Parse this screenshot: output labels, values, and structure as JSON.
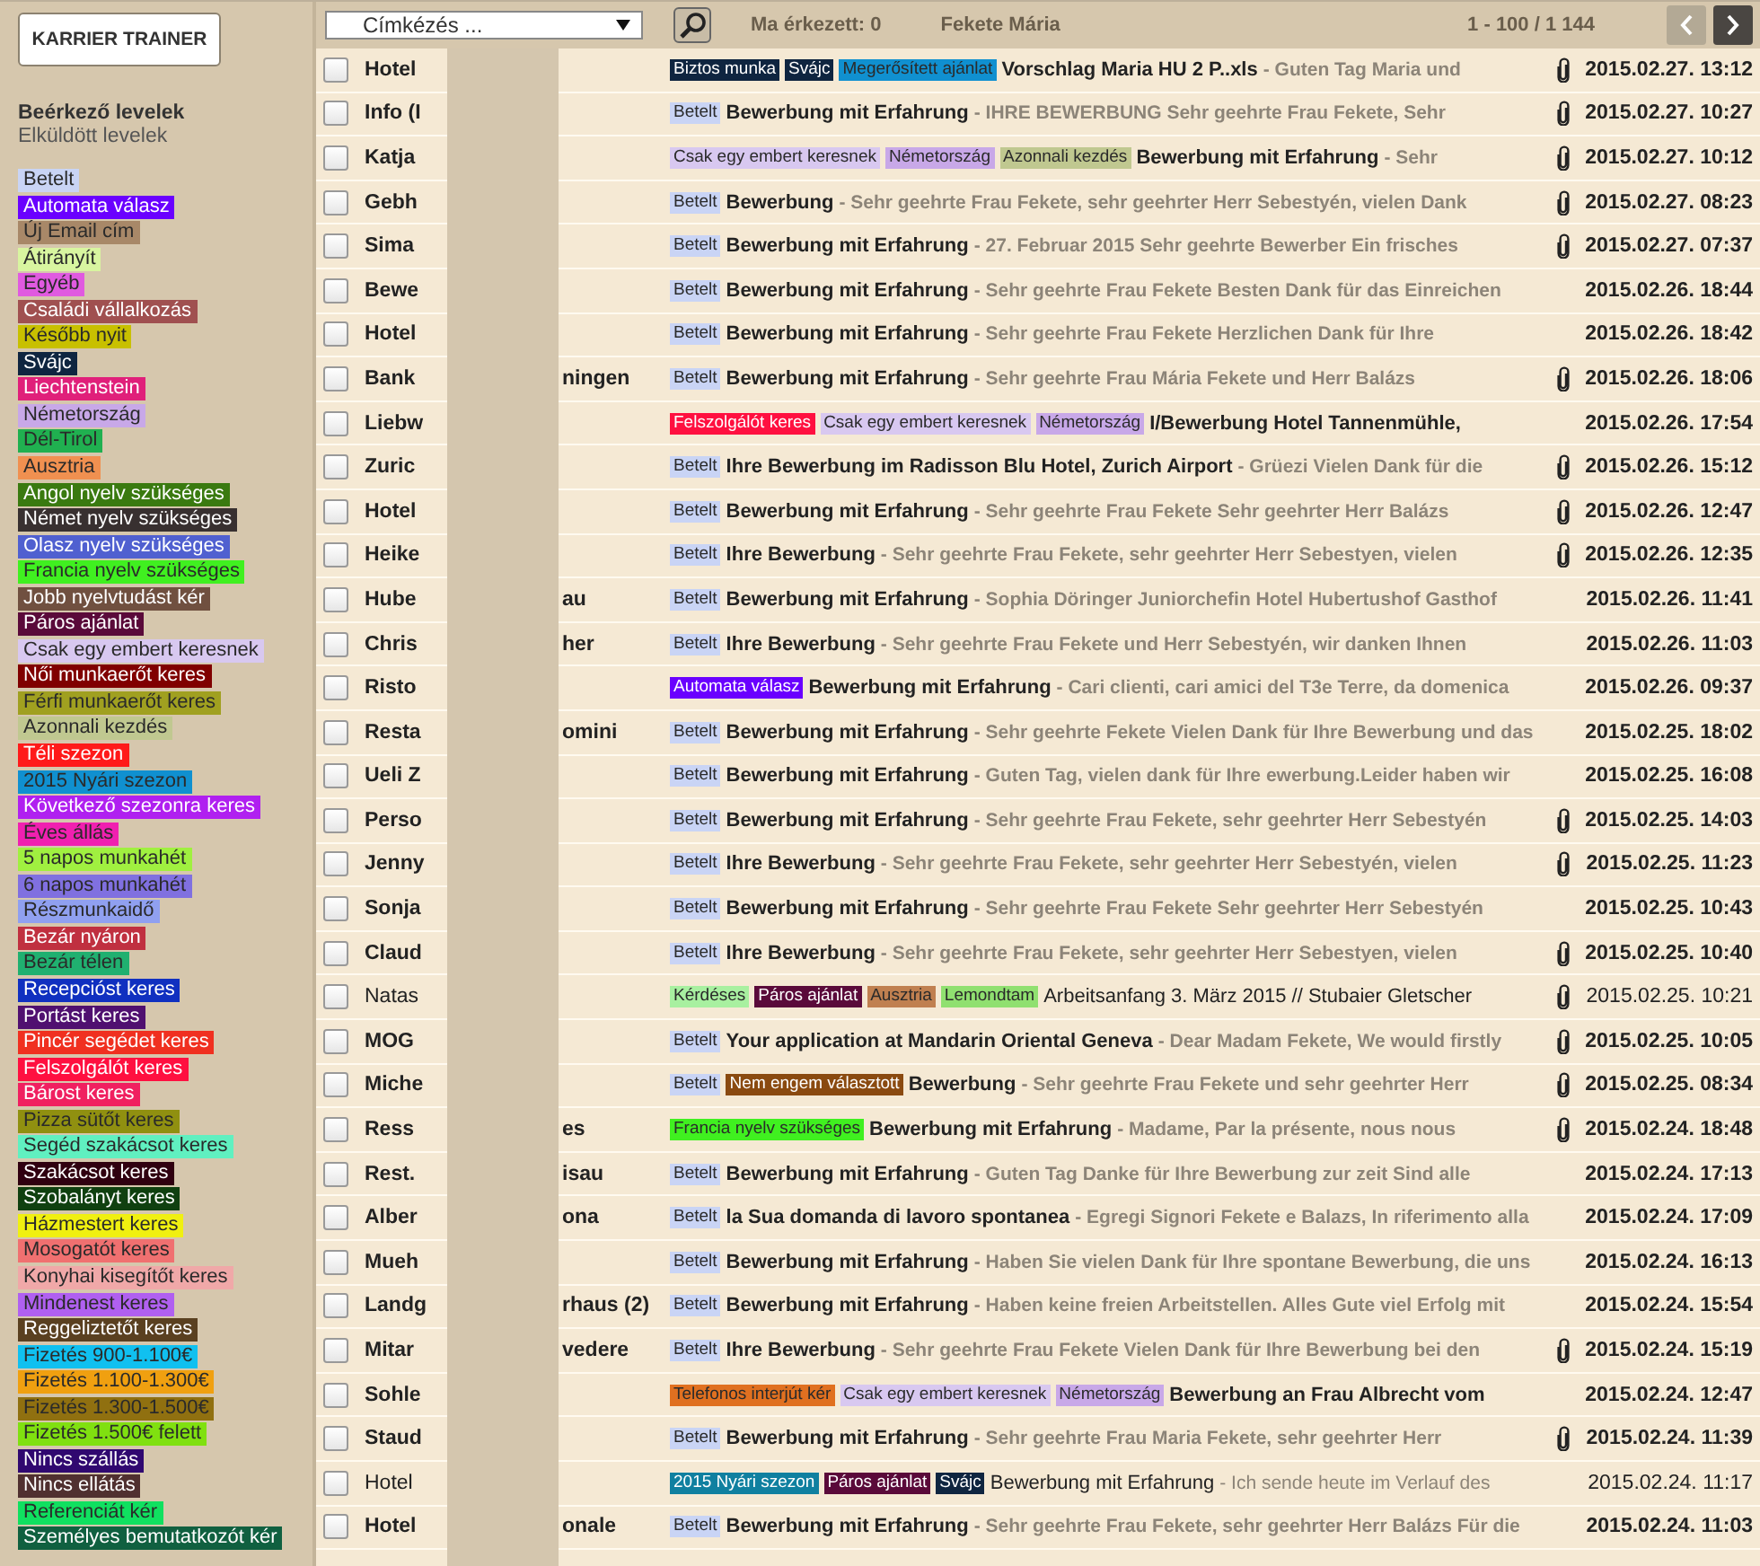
{
  "sidebar": {
    "brand_button": "KARRIER TRAINER",
    "folders": [
      {
        "label": "Beérkező levelek",
        "selected": true
      },
      {
        "label": "Elküldött levelek",
        "selected": false
      }
    ],
    "labels": [
      {
        "label": "Betelt",
        "color": "#c9d4f5"
      },
      {
        "label": "Automata válasz",
        "color": "#6a00ff"
      },
      {
        "label": "Új Email cím",
        "color": "#a88868"
      },
      {
        "label": "Átirányít",
        "color": "#d8f5a0"
      },
      {
        "label": "Egyéb",
        "color": "#e05ae0"
      },
      {
        "label": "Családi vállalkozás",
        "color": "#a05050"
      },
      {
        "label": "Később nyit",
        "color": "#c8c000"
      },
      {
        "label": "Svájc",
        "color": "#0f2540"
      },
      {
        "label": "Liechtenstein",
        "color": "#e0207a"
      },
      {
        "label": "Németország",
        "color": "#c8a8e8"
      },
      {
        "label": "Dél-Tirol",
        "color": "#20b050"
      },
      {
        "label": "Ausztria",
        "color": "#f09050"
      },
      {
        "label": "Angol nyelv szükséges",
        "color": "#3a7a10"
      },
      {
        "label": "Német nyelv szükséges",
        "color": "#383030"
      },
      {
        "label": "Olasz nyelv szükséges",
        "color": "#5060d0"
      },
      {
        "label": "Francia nyelv szükséges",
        "color": "#40f020"
      },
      {
        "label": "Jobb nyelvtudást kér",
        "color": "#705040"
      },
      {
        "label": "Páros ajánlat",
        "color": "#5a0a3a"
      },
      {
        "label": "Csak egy embert keresnek",
        "color": "#d8c8f0"
      },
      {
        "label": "Női munkaerőt keres",
        "color": "#800000"
      },
      {
        "label": "Férfi munkaerőt keres",
        "color": "#a0a020"
      },
      {
        "label": "Azonnali kezdés",
        "color": "#c0c890"
      },
      {
        "label": "Téli szezon",
        "color": "#ff1a1a"
      },
      {
        "label": "2015 Nyári szezon",
        "color": "#1090d0"
      },
      {
        "label": "Következő szezonra keres",
        "color": "#b020f0"
      },
      {
        "label": "Éves állás",
        "color": "#f020b0"
      },
      {
        "label": "5 napos munkahét",
        "color": "#a0f040"
      },
      {
        "label": "6 napos munkahét",
        "color": "#8070e0"
      },
      {
        "label": "Részmunkaidő",
        "color": "#90a0f0"
      },
      {
        "label": "Bezár nyáron",
        "color": "#c03040"
      },
      {
        "label": "Bezár télen",
        "color": "#20b070"
      },
      {
        "label": "Recepcióst keres",
        "color": "#1030c0"
      },
      {
        "label": "Portást keres",
        "color": "#501070"
      },
      {
        "label": "Pincér segédet keres",
        "color": "#f03020"
      },
      {
        "label": "Felszolgálót keres",
        "color": "#ff1040"
      },
      {
        "label": "Bárost keres",
        "color": "#f02060"
      },
      {
        "label": "Pizza sütőt keres",
        "color": "#909010"
      },
      {
        "label": "Segéd szakácsot keres",
        "color": "#60f0c0"
      },
      {
        "label": "Szakácsot keres",
        "color": "#300010"
      },
      {
        "label": "Szobalányt keres",
        "color": "#104010"
      },
      {
        "label": "Házmestert keres",
        "color": "#f0f010"
      },
      {
        "label": "Mosogatót keres",
        "color": "#f07070"
      },
      {
        "label": "Konyhai kisegítőt keres",
        "color": "#f0a8a8"
      },
      {
        "label": "Mindenest keres",
        "color": "#b060f0"
      },
      {
        "label": "Reggeliztetőt keres",
        "color": "#5a4020"
      },
      {
        "label": "Fizetés 900-1.100€",
        "color": "#10c0f0"
      },
      {
        "label": "Fizetés 1.100-1.300€",
        "color": "#f0a010"
      },
      {
        "label": "Fizetés 1.300-1.500€",
        "color": "#907010"
      },
      {
        "label": "Fizetés 1.500€ felett",
        "color": "#80e010"
      },
      {
        "label": "Nincs szállás",
        "color": "#300870"
      },
      {
        "label": "Nincs ellátás",
        "color": "#503030"
      },
      {
        "label": "Referenciát kér",
        "color": "#10e060"
      },
      {
        "label": "Személyes bemutatkozót kér",
        "color": "#106040"
      }
    ]
  },
  "toolbar": {
    "label_dropdown": "Címkézés ...",
    "today": "Ma érkezett: 0",
    "user": "Fekete Mária",
    "range": "1 - 100 / 1 144",
    "prev_disabled": true,
    "next_disabled": false
  },
  "messages": [
    {
      "checked": false,
      "read": false,
      "sender": "Hotel",
      "tags": [
        {
          "label": "Biztos munka",
          "color": "#0f2540"
        },
        {
          "label": "Svájc",
          "color": "#0f2540"
        },
        {
          "label": "Megerősített ajánlat",
          "color": "#1090d0"
        }
      ],
      "subject": "Vorschlag Maria HU 2 P..xls",
      "preview": "- Guten Tag Maria und",
      "attachment": true,
      "date": "2015.02.27. 13:12"
    },
    {
      "checked": false,
      "read": false,
      "sender": "Info (I",
      "tags": [
        {
          "label": "Betelt",
          "color": "#c9d4f5"
        }
      ],
      "subject": "Bewerbung mit Erfahrung",
      "preview": "- IHRE BEWERBUNG Sehr geehrte Frau Fekete, Sehr",
      "attachment": true,
      "date": "2015.02.27. 10:27"
    },
    {
      "checked": false,
      "read": false,
      "sender": "Katja",
      "tags": [
        {
          "label": "Csak egy embert keresnek",
          "color": "#d8c8f0"
        },
        {
          "label": "Németország",
          "color": "#c8a8e8"
        },
        {
          "label": "Azonnali kezdés",
          "color": "#c0c890"
        }
      ],
      "subject": "Bewerbung mit Erfahrung",
      "preview": "- Sehr",
      "attachment": true,
      "date": "2015.02.27. 10:12"
    },
    {
      "checked": false,
      "read": false,
      "sender": "Gebh",
      "tags": [
        {
          "label": "Betelt",
          "color": "#c9d4f5"
        }
      ],
      "subject": "Bewerbung",
      "preview": "- Sehr geehrte Frau Fekete, sehr geehrter Herr Sebestyén, vielen Dank",
      "attachment": true,
      "date": "2015.02.27. 08:23"
    },
    {
      "checked": false,
      "read": false,
      "sender": "Sima",
      "tags": [
        {
          "label": "Betelt",
          "color": "#c9d4f5"
        }
      ],
      "subject": "Bewerbung mit Erfahrung",
      "preview": "- 27. Februar 2015 Sehr geehrte Bewerber Ein frisches",
      "attachment": true,
      "date": "2015.02.27. 07:37"
    },
    {
      "checked": false,
      "read": false,
      "sender": "Bewe",
      "tags": [
        {
          "label": "Betelt",
          "color": "#c9d4f5"
        }
      ],
      "subject": "Bewerbung mit Erfahrung",
      "preview": "- Sehr geehrte Frau Fekete Besten Dank für das Einreichen",
      "attachment": false,
      "date": "2015.02.26. 18:44"
    },
    {
      "checked": false,
      "read": false,
      "sender": "Hotel",
      "tags": [
        {
          "label": "Betelt",
          "color": "#c9d4f5"
        }
      ],
      "subject": "Bewerbung mit Erfahrung",
      "preview": "- Sehr geehrte Frau Fekete Herzlichen Dank für Ihre",
      "attachment": false,
      "date": "2015.02.26. 18:42"
    },
    {
      "checked": false,
      "read": false,
      "sender": "Bank",
      "sender_tail": "ningen",
      "tags": [
        {
          "label": "Betelt",
          "color": "#c9d4f5"
        }
      ],
      "subject": "Bewerbung mit Erfahrung",
      "preview": "- Sehr geehrte Frau Mária Fekete und Herr Balázs",
      "attachment": true,
      "date": "2015.02.26. 18:06"
    },
    {
      "checked": false,
      "read": false,
      "sender": "Liebw",
      "tags": [
        {
          "label": "Felszolgálót keres",
          "color": "#ff1040"
        },
        {
          "label": "Csak egy embert keresnek",
          "color": "#d8c8f0"
        },
        {
          "label": "Németország",
          "color": "#c8a8e8"
        }
      ],
      "subject": "I/Bewerbung Hotel Tannenmühle,",
      "attachment": false,
      "date": "2015.02.26. 17:54"
    },
    {
      "checked": false,
      "read": false,
      "sender": "Zuric",
      "tags": [
        {
          "label": "Betelt",
          "color": "#c9d4f5"
        }
      ],
      "subject": "Ihre Bewerbung im Radisson Blu Hotel, Zurich Airport",
      "preview": "- Grüezi Vielen Dank für die",
      "attachment": true,
      "date": "2015.02.26. 15:12"
    },
    {
      "checked": false,
      "read": false,
      "sender": "Hotel",
      "tags": [
        {
          "label": "Betelt",
          "color": "#c9d4f5"
        }
      ],
      "subject": "Bewerbung mit Erfahrung",
      "preview": "- Sehr geehrte Frau Fekete Sehr geehrter Herr Balázs",
      "attachment": true,
      "date": "2015.02.26. 12:47"
    },
    {
      "checked": false,
      "read": false,
      "sender": "Heike",
      "tags": [
        {
          "label": "Betelt",
          "color": "#c9d4f5"
        }
      ],
      "subject": "Ihre Bewerbung",
      "preview": "- Sehr geehrte Frau Fekete, sehr geehrter Herr Sebestyen, vielen",
      "attachment": true,
      "date": "2015.02.26. 12:35"
    },
    {
      "checked": false,
      "read": false,
      "sender": "Hube",
      "sender_tail": "au",
      "tags": [
        {
          "label": "Betelt",
          "color": "#c9d4f5"
        }
      ],
      "subject": "Bewerbung mit Erfahrung",
      "preview": "- Sophia Döringer Juniorchefin Hotel Hubertushof Gasthof",
      "attachment": false,
      "date": "2015.02.26. 11:41"
    },
    {
      "checked": false,
      "read": false,
      "sender": "Chris",
      "sender_tail": "her",
      "tags": [
        {
          "label": "Betelt",
          "color": "#c9d4f5"
        }
      ],
      "subject": "Ihre Bewerbung",
      "preview": "- Sehr geehrte Frau Fekete und Herr Sebestyén, wir danken Ihnen",
      "attachment": false,
      "date": "2015.02.26. 11:03"
    },
    {
      "checked": false,
      "read": false,
      "sender": "Risto",
      "tags": [
        {
          "label": "Automata válasz",
          "color": "#6a00ff"
        }
      ],
      "subject": "Bewerbung mit Erfahrung",
      "preview": "- Cari clienti, cari amici del T3e Terre, da domenica",
      "attachment": false,
      "date": "2015.02.26. 09:37"
    },
    {
      "checked": false,
      "read": false,
      "sender": "Resta",
      "sender_tail": "omini",
      "tags": [
        {
          "label": "Betelt",
          "color": "#c9d4f5"
        }
      ],
      "subject": "Bewerbung mit Erfahrung",
      "preview": "- Sehr geehrte Fekete Vielen Dank für Ihre Bewerbung und das",
      "attachment": false,
      "date": "2015.02.25. 18:02"
    },
    {
      "checked": false,
      "read": false,
      "sender": "Ueli Z",
      "tags": [
        {
          "label": "Betelt",
          "color": "#c9d4f5"
        }
      ],
      "subject": "Bewerbung mit Erfahrung",
      "preview": "- Guten Tag, vielen dank für Ihre ewerbung.Leider haben wir",
      "attachment": false,
      "date": "2015.02.25. 16:08"
    },
    {
      "checked": false,
      "read": false,
      "sender": "Perso",
      "tags": [
        {
          "label": "Betelt",
          "color": "#c9d4f5"
        }
      ],
      "subject": "Bewerbung mit Erfahrung",
      "preview": "- Sehr geehrte Frau Fekete, sehr geehrter Herr Sebestyén",
      "attachment": true,
      "date": "2015.02.25. 14:03"
    },
    {
      "checked": false,
      "read": false,
      "sender": "Jenny",
      "tags": [
        {
          "label": "Betelt",
          "color": "#c9d4f5"
        }
      ],
      "subject": "Ihre Bewerbung",
      "preview": "- Sehr geehrte Frau Fekete, sehr geehrter Herr Sebestyén, vielen",
      "attachment": true,
      "date": "2015.02.25. 11:23"
    },
    {
      "checked": false,
      "read": false,
      "sender": "Sonja",
      "tags": [
        {
          "label": "Betelt",
          "color": "#c9d4f5"
        }
      ],
      "subject": "Bewerbung mit Erfahrung",
      "preview": "- Sehr geehrte Frau Fekete Sehr geehrter Herr Sebestyén",
      "attachment": false,
      "date": "2015.02.25. 10:43"
    },
    {
      "checked": false,
      "read": false,
      "sender": "Claud",
      "tags": [
        {
          "label": "Betelt",
          "color": "#c9d4f5"
        }
      ],
      "subject": "Ihre Bewerbung",
      "preview": "- Sehr geehrte Frau Fekete, sehr geehrter Herr Sebestyen, vielen",
      "attachment": true,
      "date": "2015.02.25. 10:40"
    },
    {
      "checked": false,
      "read": true,
      "sender": "Natas",
      "tags": [
        {
          "label": "Kérdéses",
          "color": "#a8f0a0"
        },
        {
          "label": "Páros ajánlat",
          "color": "#5a0a3a"
        },
        {
          "label": "Ausztria",
          "color": "#c08050"
        },
        {
          "label": "Lemondtam",
          "color": "#90e070"
        }
      ],
      "subject": "Arbeitsanfang 3. März 2015 // Stubaier Gletscher",
      "attachment": true,
      "date": "2015.02.25. 10:21"
    },
    {
      "checked": false,
      "read": false,
      "sender": "MOG",
      "tags": [
        {
          "label": "Betelt",
          "color": "#c9d4f5"
        }
      ],
      "subject": "Your application at Mandarin Oriental Geneva",
      "preview": "- Dear Madam Fekete, We would firstly",
      "attachment": true,
      "date": "2015.02.25. 10:05"
    },
    {
      "checked": false,
      "read": false,
      "sender": "Miche",
      "tags": [
        {
          "label": "Betelt",
          "color": "#c9d4f5"
        },
        {
          "label": "Nem engem választott",
          "color": "#8a4a10"
        }
      ],
      "subject": "Bewerbung",
      "preview": "- Sehr geehrte Frau Fekete und sehr geehrter Herr",
      "attachment": true,
      "date": "2015.02.25. 08:34"
    },
    {
      "checked": false,
      "read": false,
      "sender": "Ress",
      "sender_tail": "es",
      "tags": [
        {
          "label": "Francia nyelv szükséges",
          "color": "#40f020"
        }
      ],
      "subject": "Bewerbung mit Erfahrung",
      "preview": "- Madame, Par la présente, nous nous",
      "attachment": true,
      "date": "2015.02.24. 18:48"
    },
    {
      "checked": false,
      "read": false,
      "sender": "Rest.",
      "sender_tail": "isau",
      "tags": [
        {
          "label": "Betelt",
          "color": "#c9d4f5"
        }
      ],
      "subject": "Bewerbung mit Erfahrung",
      "preview": "- Guten Tag Danke für Ihre Bewerbung zur zeit Sind alle",
      "attachment": false,
      "date": "2015.02.24. 17:13"
    },
    {
      "checked": false,
      "read": false,
      "sender": "Alber",
      "sender_tail": "ona",
      "tags": [
        {
          "label": "Betelt",
          "color": "#c9d4f5"
        }
      ],
      "subject": "la Sua domanda di lavoro spontanea",
      "preview": "- Egregi Signori Fekete e Balazs, In riferimento alla",
      "attachment": false,
      "date": "2015.02.24. 17:09"
    },
    {
      "checked": false,
      "read": false,
      "sender": "Mueh",
      "tags": [
        {
          "label": "Betelt",
          "color": "#c9d4f5"
        }
      ],
      "subject": "Bewerbung mit Erfahrung",
      "preview": "- Haben Sie vielen Dank für Ihre spontane Bewerbung, die uns",
      "attachment": false,
      "date": "2015.02.24. 16:13"
    },
    {
      "checked": false,
      "read": false,
      "sender": "Landg",
      "sender_tail": "rhaus (2)",
      "tags": [
        {
          "label": "Betelt",
          "color": "#c9d4f5"
        }
      ],
      "subject": "Bewerbung mit Erfahrung",
      "preview": "- Haben keine freien Arbeitstellen. Alles Gute viel Erfolg mit",
      "attachment": false,
      "date": "2015.02.24. 15:54"
    },
    {
      "checked": false,
      "read": false,
      "sender": "Mitar",
      "sender_tail": "vedere",
      "tags": [
        {
          "label": "Betelt",
          "color": "#c9d4f5"
        }
      ],
      "subject": "Ihre Bewerbung",
      "preview": "- Sehr geehrte Frau Fekete Vielen Dank für Ihre Bewerbung bei den",
      "attachment": true,
      "date": "2015.02.24. 15:19"
    },
    {
      "checked": false,
      "read": false,
      "sender": "Sohle",
      "tags": [
        {
          "label": "Telefonos interjút kér",
          "color": "#e07020"
        },
        {
          "label": "Csak egy embert keresnek",
          "color": "#d8c8f0"
        },
        {
          "label": "Németország",
          "color": "#c8a8e8"
        }
      ],
      "subject": "Bewerbung an Frau Albrecht vom",
      "attachment": false,
      "date": "2015.02.24. 12:47"
    },
    {
      "checked": false,
      "read": false,
      "sender": "Staud",
      "tags": [
        {
          "label": "Betelt",
          "color": "#c9d4f5"
        }
      ],
      "subject": "Bewerbung mit Erfahrung",
      "preview": "- Sehr geehrte Frau Maria Fekete, sehr geehrter Herr",
      "attachment": true,
      "date": "2015.02.24. 11:39"
    },
    {
      "checked": false,
      "read": true,
      "sender": "Hotel",
      "tags": [
        {
          "label": "2015 Nyári szezon",
          "color": "#1080a0"
        },
        {
          "label": "Páros ajánlat",
          "color": "#5a0a3a"
        },
        {
          "label": "Svájc",
          "color": "#0f2540"
        }
      ],
      "subject": "Bewerbung mit Erfahrung",
      "preview": "- Ich sende heute im Verlauf des",
      "attachment": false,
      "date": "2015.02.24. 11:17"
    },
    {
      "checked": false,
      "read": false,
      "sender": "Hotel",
      "sender_tail": "onale",
      "tags": [
        {
          "label": "Betelt",
          "color": "#c9d4f5"
        }
      ],
      "subject": "Bewerbung mit Erfahrung",
      "preview": "- Sehr geehrte Frau Fekete, sehr geehrter Herr Balázs Für die",
      "attachment": false,
      "date": "2015.02.24. 11:03"
    }
  ]
}
